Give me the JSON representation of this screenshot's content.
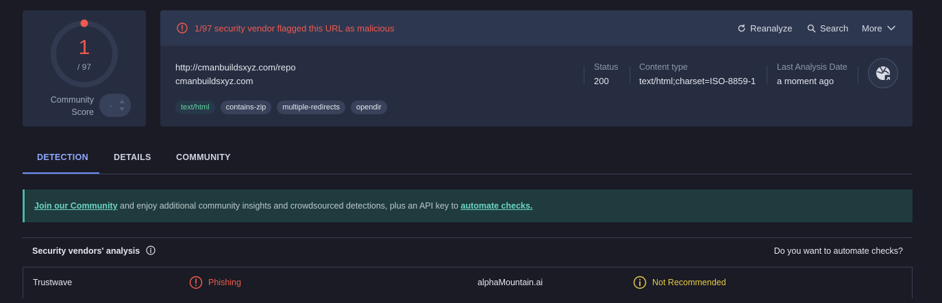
{
  "score": {
    "value": "1",
    "total": "/ 97",
    "community_label": "Community Score",
    "community_stepper_value": "-"
  },
  "alert": {
    "text": "1/97 security vendor flagged this URL as malicious",
    "icon": "alert-circle-icon"
  },
  "actions": {
    "reanalyze": "Reanalyze",
    "search": "Search",
    "more": "More"
  },
  "target": {
    "url": "http://cmanbuildsxyz.com/repo",
    "domain": "cmanbuildsxyz.com",
    "tags": [
      "text/html",
      "contains-zip",
      "multiple-redirects",
      "opendir"
    ]
  },
  "meta": {
    "status_label": "Status",
    "status_value": "200",
    "content_type_label": "Content type",
    "content_type_value": "text/html;charset=ISO-8859-1",
    "last_analysis_label": "Last Analysis Date",
    "last_analysis_value": "a moment ago"
  },
  "tabs": [
    "DETECTION",
    "DETAILS",
    "COMMUNITY"
  ],
  "banner": {
    "link1": "Join our Community",
    "middle": " and enjoy additional community insights and crowdsourced detections, plus an API key to ",
    "link2": "automate checks."
  },
  "vendors": {
    "title": "Security vendors' analysis",
    "automate_question": "Do you want to automate checks?",
    "rows": [
      {
        "vendor_a": "Trustwave",
        "verdict_a": "Phishing",
        "vendor_b": "alphaMountain.ai",
        "verdict_b": "Not Recommended"
      }
    ]
  },
  "colors": {
    "malicious": "#f05a4f",
    "warning": "#e6c84a",
    "accent": "#8ea8ff",
    "banner_link": "#6cd3c3"
  }
}
